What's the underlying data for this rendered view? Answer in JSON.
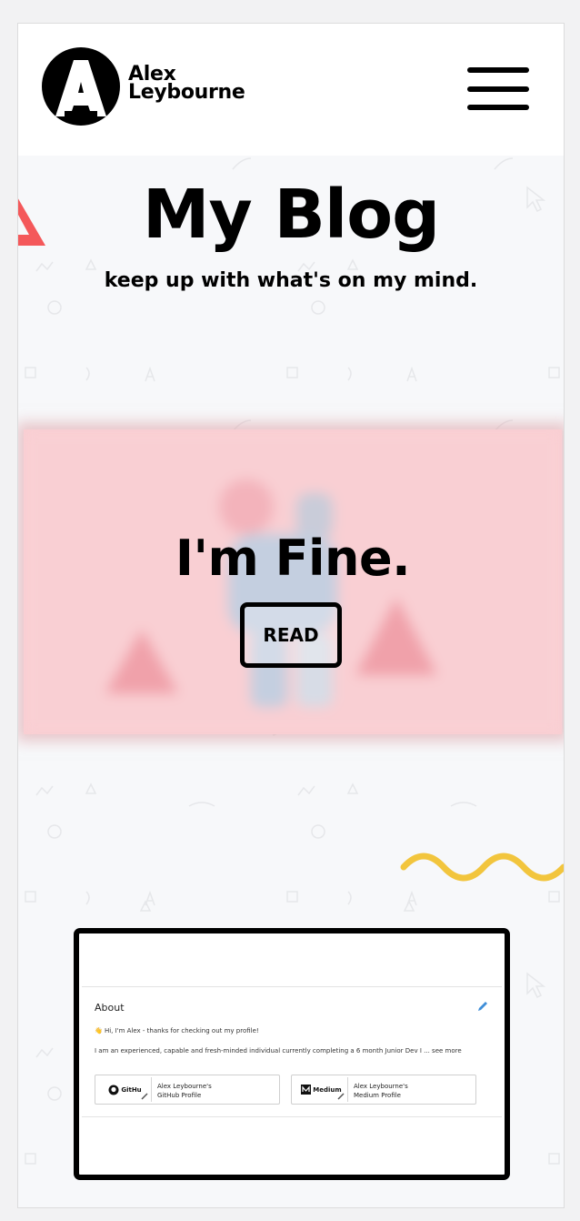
{
  "brand": {
    "first_name": "Alex",
    "last_name": "Leybourne"
  },
  "hero": {
    "title": "My Blog",
    "subtitle": "keep up with what's on my mind."
  },
  "featured_post": {
    "title": "I'm Fine.",
    "read_label": "READ"
  },
  "preview": {
    "about_title": "About",
    "greeting_emoji": "👋",
    "greeting": "Hi, I'm Alex - thanks for checking out my profile!",
    "description": "I am an experienced, capable and fresh-minded individual currently completing a 6 month Junior Dev I ...",
    "see_more": "see more",
    "profiles": [
      {
        "thumb_label": "GitHu",
        "name": "Alex Leybourne's",
        "sub": "GitHub Profile"
      },
      {
        "thumb_label": "Medium",
        "name": "Alex Leybourne's",
        "sub": "Medium Profile"
      }
    ]
  },
  "colors": {
    "accent_red": "#f4585a",
    "accent_yellow": "#f2c53d",
    "card_pink": "#f9cfd3",
    "text": "#000000"
  },
  "icons": [
    "logo-a-icon",
    "hamburger-menu-icon",
    "pencil-icon",
    "github-icon",
    "medium-icon",
    "link-icon"
  ]
}
